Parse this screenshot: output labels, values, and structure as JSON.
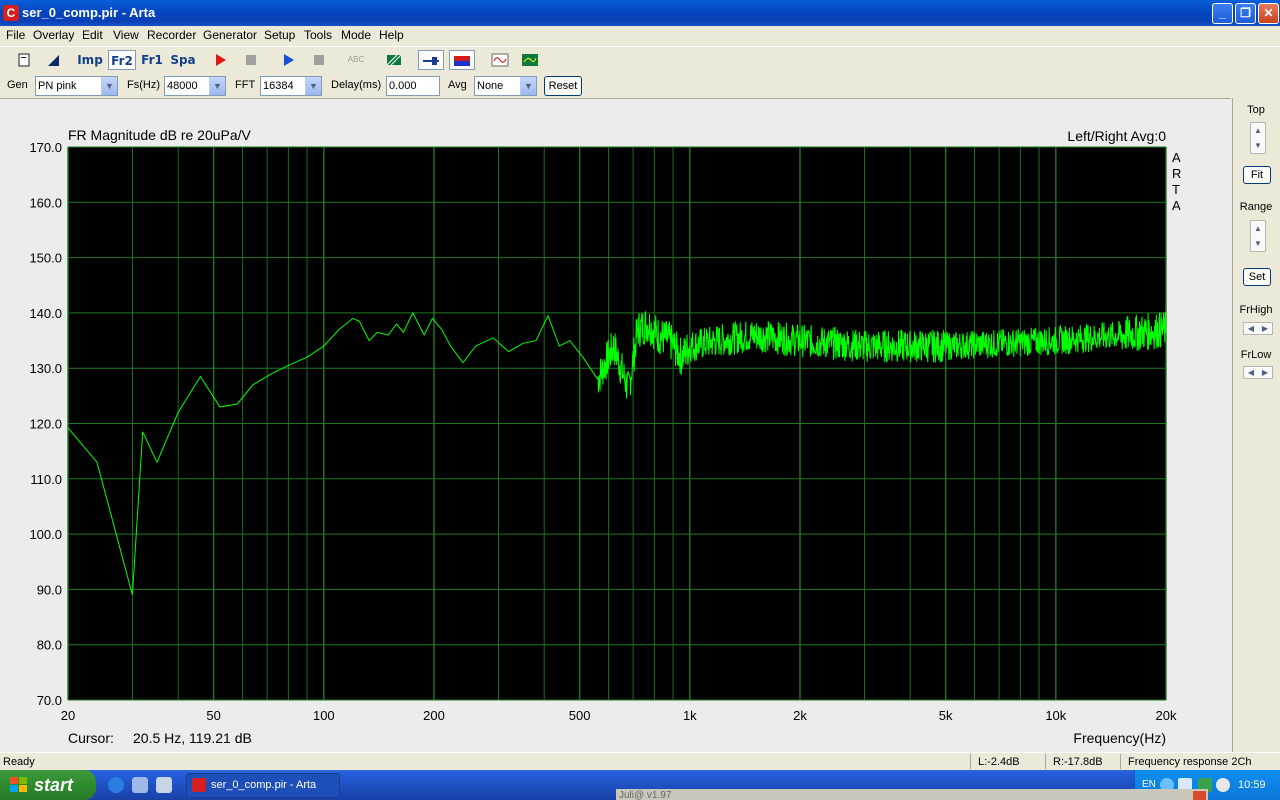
{
  "window": {
    "title": "ser_0_comp.pir - Arta",
    "app_icon": "C",
    "minimize": "_",
    "maximize": "❐",
    "close": "✕"
  },
  "menu": [
    "File",
    "Overlay",
    "Edit",
    "View",
    "Recorder",
    "Generator",
    "Setup",
    "Tools",
    "Mode",
    "Help"
  ],
  "toolbar": {
    "imp": "Imp",
    "fr2": "Fr2",
    "fr1": "Fr1",
    "spa": "Spa",
    "abc": "ABC"
  },
  "params": {
    "gen_label": "Gen",
    "gen_value": "PN pink",
    "fs_label": "Fs(Hz)",
    "fs_value": "48000",
    "fft_label": "FFT",
    "fft_value": "16384",
    "delay_label": "Delay(ms)",
    "delay_value": "0.000",
    "avg_label": "Avg",
    "avg_value": "None",
    "reset_label": "Reset"
  },
  "side": {
    "top_label": "Top",
    "fit_label": "Fit",
    "range_label": "Range",
    "set_label": "Set",
    "frhigh_label": "FrHigh",
    "frlow_label": "FrLow"
  },
  "plot": {
    "title": "FR Magnitude dB re 20uPa/V",
    "channel_info": "Left/Right  Avg:0",
    "arta_letters": [
      "A",
      "R",
      "T",
      "A"
    ],
    "cursor_label": "Cursor:",
    "cursor_value": "20.5 Hz, 119.21 dB",
    "xlabel": "Frequency(Hz)"
  },
  "chart_data": {
    "type": "line",
    "title": "FR Magnitude dB re 20uPa/V",
    "xlabel": "Frequency(Hz)",
    "ylabel": "",
    "xscale": "log",
    "xlim": [
      20,
      20000
    ],
    "ylim": [
      70,
      170
    ],
    "grid": true,
    "line_color": "#00ff00",
    "background": "#000000",
    "grid_color": "#1f7a1f",
    "y_ticks": [
      "170.0",
      "160.0",
      "150.0",
      "140.0",
      "130.0",
      "120.0",
      "110.0",
      "100.0",
      "90.0",
      "80.0",
      "70.0"
    ],
    "x_ticks": [
      "20",
      "50",
      "100",
      "200",
      "500",
      "1k",
      "2k",
      "5k",
      "10k",
      "20k"
    ],
    "x_tick_values": [
      20,
      50,
      100,
      200,
      500,
      1000,
      2000,
      5000,
      10000,
      20000
    ],
    "series": [
      {
        "x": [
          20,
          24,
          30,
          32,
          35,
          40,
          46,
          52,
          58,
          64,
          72,
          80,
          90,
          100,
          110,
          120,
          125,
          133,
          140,
          150,
          158,
          165,
          175,
          188,
          198,
          210,
          222,
          240,
          260,
          290,
          320,
          350,
          380,
          410,
          440,
          470,
          510,
          560,
          620,
          680,
          720,
          770,
          820,
          880,
          950,
          1000,
          1200,
          1500,
          2000,
          3000,
          5000,
          10000,
          15000,
          20000
        ],
        "y": [
          119.2,
          113,
          89,
          118.5,
          113,
          122,
          128.5,
          123,
          123.5,
          127,
          129,
          130.5,
          132,
          134,
          137,
          139,
          138.5,
          135,
          136.5,
          136,
          138,
          136.5,
          140,
          136,
          139,
          137,
          134,
          131,
          134,
          135.5,
          133,
          134.5,
          135,
          139.5,
          134,
          135,
          132,
          128,
          134,
          126,
          137,
          138,
          136,
          135,
          132,
          134,
          135,
          136,
          135,
          134,
          134,
          135,
          136,
          137
        ]
      }
    ]
  },
  "status": {
    "ready": "Ready",
    "l_level": "L:-2.4dB",
    "r_level": "R:-17.8dB",
    "mode": "Frequency response 2Ch"
  },
  "taskbar": {
    "start_label": "start",
    "task_label": "ser_0_comp.pir - Arta",
    "lang": "EN",
    "clock": "10:59",
    "ghost_window": "Juli@ v1.97"
  }
}
